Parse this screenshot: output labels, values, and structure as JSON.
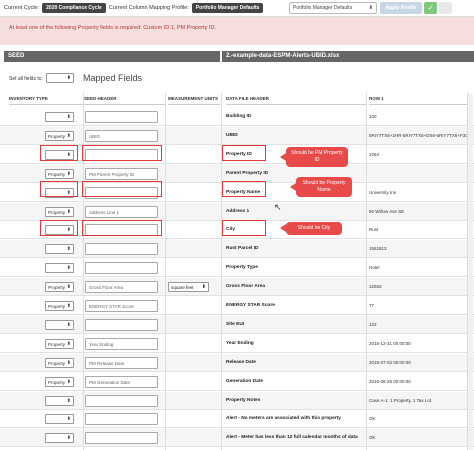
{
  "topbar": {
    "current_cycle_label": "Current Cycle:",
    "cycle_value": "2020 Compliance Cycle",
    "mapping_label": "Current Column Mapping Profile:",
    "mapping_value": "Portfolio Manager Defaults",
    "profile_select": "Portfolio Manager Defaults",
    "apply_label": "Apply Profile",
    "ok_glyph": "✓"
  },
  "alert": {
    "text": "At least one of the following Property fields is required: Custom ID 1, PM Property ID."
  },
  "seed_band": "SEED",
  "file_band": "2.-example-data-ESPM-Alerts-UBID.xlsx",
  "set_all_label": "Set all fields to:",
  "mapped_fields_title": "Mapped Fields",
  "columns": {
    "inventory_type": "INVENTORY TYPE",
    "seed_header": "SEED HEADER",
    "measurement_units": "MEASUREMENT UNITS",
    "data_file_header": "DATA FILE HEADER",
    "row1": "ROW 1"
  },
  "rows": [
    {
      "inv": "",
      "seed": "",
      "mu": "",
      "field": "Building ID",
      "val": "100"
    },
    {
      "inv": "Property",
      "seed": "UBID",
      "mu": "",
      "field": "UBID",
      "val": "5RIY7TX6+2HR-5RIY7TX6+DS6-5RIY7TX6+F3Q"
    },
    {
      "inv": "",
      "seed": "",
      "mu": "",
      "field": "Property ID",
      "val": "2264"
    },
    {
      "inv": "Property",
      "seed": "PM Parent Property ID",
      "mu": "",
      "field": "Parent Property ID",
      "val": ""
    },
    {
      "inv": "",
      "seed": "",
      "mu": "",
      "field": "Property Name",
      "val": "University Inn"
    },
    {
      "inv": "Property",
      "seed": "Address Line 1",
      "mu": "",
      "field": "Address 1",
      "val": "50 Willow Ave SE"
    },
    {
      "inv": "",
      "seed": "",
      "mu": "",
      "field": "City",
      "val": "Rust"
    },
    {
      "inv": "",
      "seed": "",
      "mu": "",
      "field": "Rust Parcel ID",
      "val": "1552813"
    },
    {
      "inv": "",
      "seed": "",
      "mu": "",
      "field": "Property Type",
      "val": "Hotel"
    },
    {
      "inv": "Property",
      "seed": "Gross Floor Area",
      "mu": "square feet",
      "field": "Gross Floor Area",
      "val": "12553"
    },
    {
      "inv": "Property",
      "seed": "ENERGY STAR Score",
      "mu": "",
      "field": "ENERGY STAR Score",
      "val": "77"
    },
    {
      "inv": "",
      "seed": "",
      "mu": "",
      "field": "Site EUI",
      "val": "123"
    },
    {
      "inv": "Property",
      "seed": "Year Ending",
      "mu": "",
      "field": "Year Ending",
      "val": "2015-12-31 00:00:00"
    },
    {
      "inv": "Property",
      "seed": "PM Release Date",
      "mu": "",
      "field": "Release Date",
      "val": "2015-07-02 00:00:00"
    },
    {
      "inv": "Property",
      "seed": "PM Generation Date",
      "mu": "",
      "field": "Generation Date",
      "val": "2015-06-25 00:00:00"
    },
    {
      "inv": "",
      "seed": "",
      "mu": "",
      "field": "Property Notes",
      "val": "Case A-1: 1 Property, 1 Tax Lot"
    },
    {
      "inv": "",
      "seed": "",
      "mu": "",
      "field": "Alert - No meters are associated with this property",
      "val": "Ok"
    },
    {
      "inv": "",
      "seed": "",
      "mu": "",
      "field": "Alert - Meter has less than 12 full calendar months of data",
      "val": "Ok"
    }
  ],
  "callouts": {
    "pm_id": "Should be PM Property ID",
    "prop_name": "Should be Property Name",
    "city": "Should be City"
  },
  "colors": {
    "alert_bg": "#f6dede",
    "alert_text": "#b23a3a",
    "highlight": "#e03a3a",
    "band": "#666666"
  }
}
